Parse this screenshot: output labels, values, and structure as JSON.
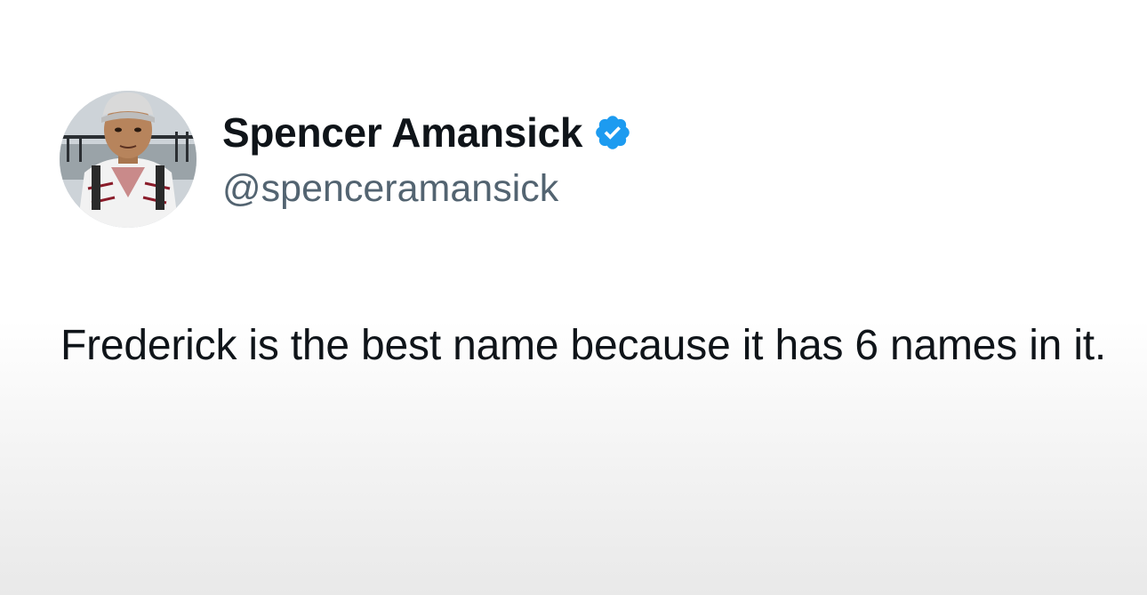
{
  "tweet": {
    "author": {
      "display_name": "Spencer Amansick",
      "handle": "@spenceramansick",
      "verified": true,
      "avatar_icon": "profile-photo"
    },
    "text": "Frederick is the best name because it has 6 names in it."
  },
  "colors": {
    "verified_blue": "#1d9bf0",
    "text_primary": "#0f1419",
    "text_secondary": "#536471"
  }
}
